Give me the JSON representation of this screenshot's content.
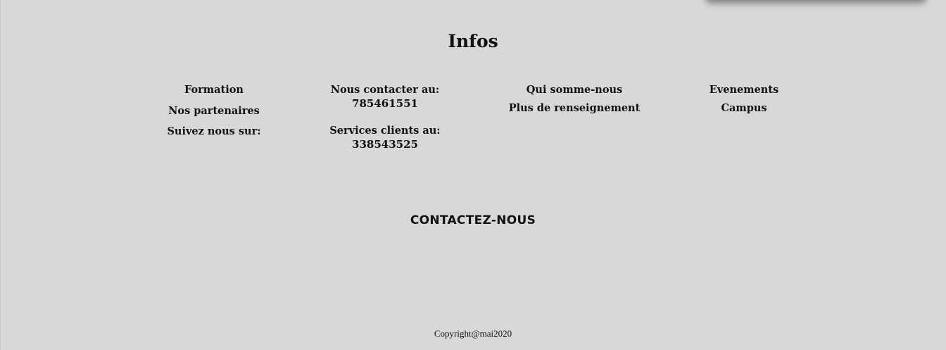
{
  "infos": {
    "title": "Infos"
  },
  "columns": {
    "col1": {
      "formation": "Formation",
      "partenaires": "Nos partenaires",
      "suivez": "Suivez nous sur:"
    },
    "col2": {
      "contact_label": "Nous contacter au:",
      "contact_number": "785461551",
      "services_label": "Services clients au:",
      "services_number": "338543525"
    },
    "col3": {
      "qui": "Qui somme-nous",
      "renseignement": "Plus de renseignement"
    },
    "col4": {
      "evenements": "Evenements",
      "campus": "Campus"
    }
  },
  "contact": {
    "title": "CONTACTEZ-NOUS"
  },
  "footer": {
    "copyright": "Copyright@mai2020"
  }
}
